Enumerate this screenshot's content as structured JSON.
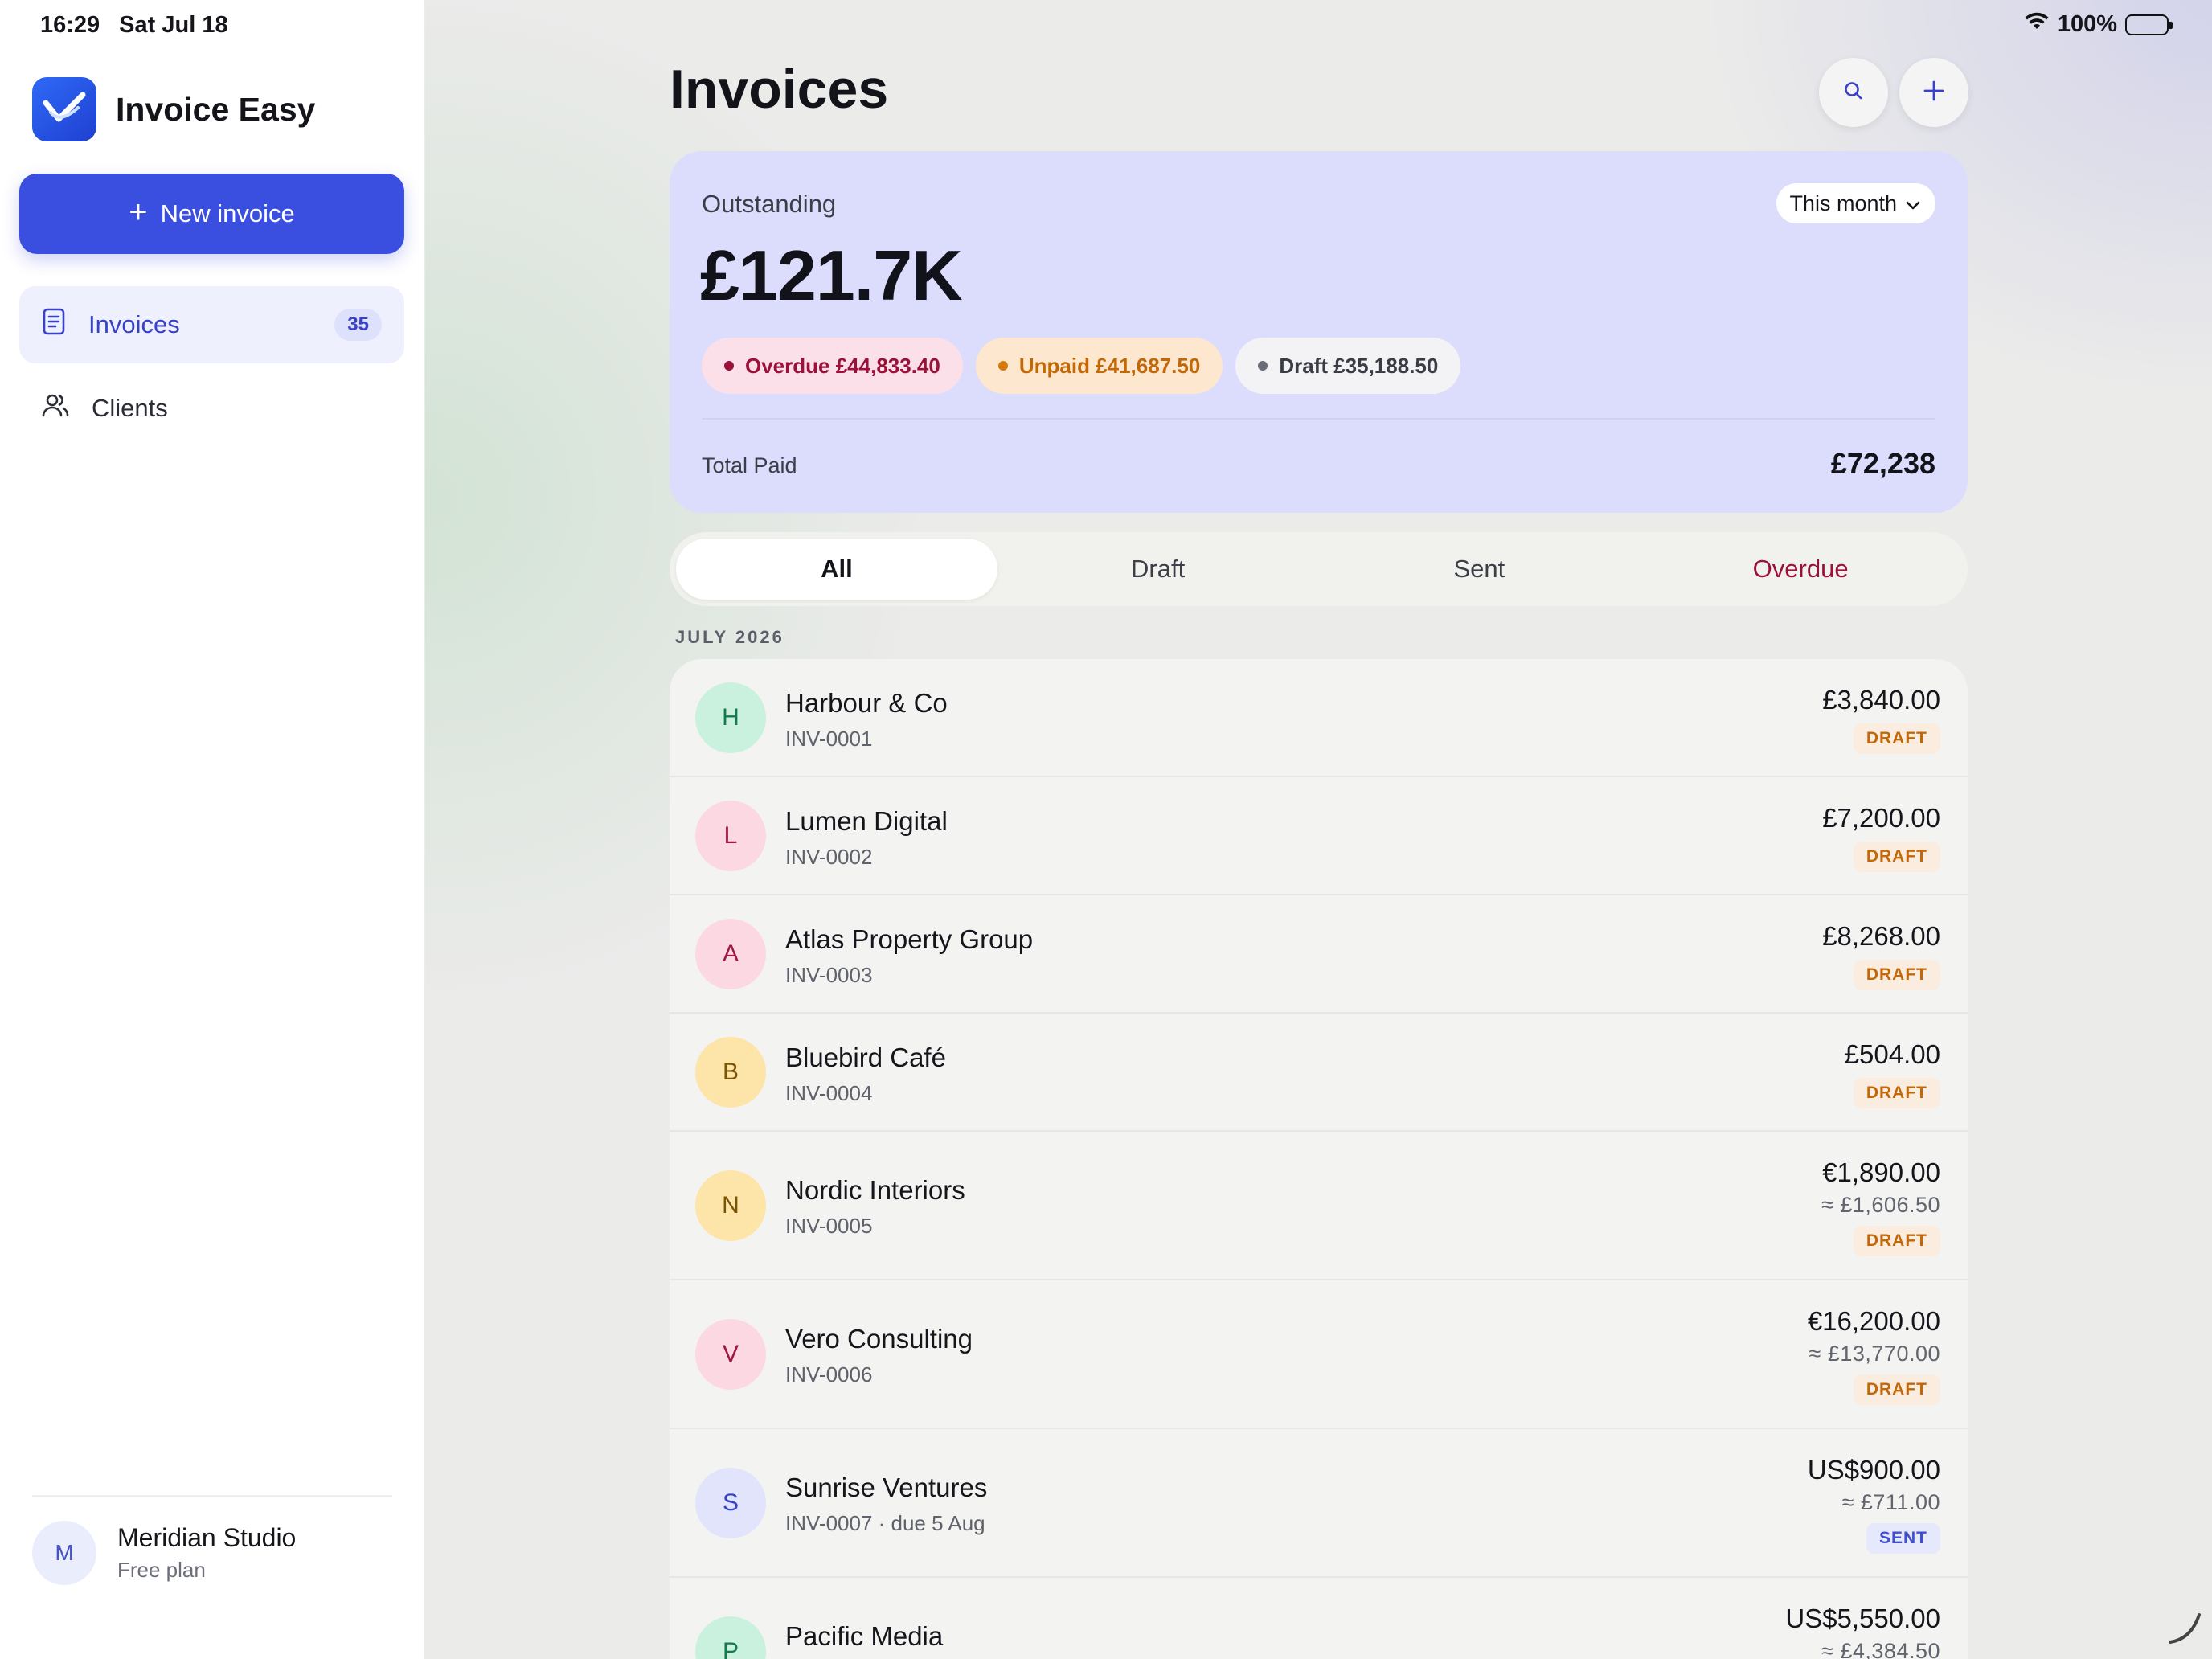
{
  "status_bar": {
    "time": "16:29",
    "date": "Sat Jul 18",
    "battery": "100%",
    "wifi_icon": "wifi-icon",
    "battery_icon": "battery-icon"
  },
  "sidebar": {
    "app_name": "Invoice Easy",
    "new_invoice_label": "New invoice",
    "items": [
      {
        "label": "Invoices",
        "count": "35",
        "icon": "document-icon",
        "active": true
      },
      {
        "label": "Clients",
        "icon": "users-icon",
        "active": false
      }
    ],
    "account": {
      "initial": "M",
      "name": "Meridian Studio",
      "plan": "Free plan"
    }
  },
  "header": {
    "title": "Invoices",
    "search_icon": "search-icon",
    "add_icon": "plus-icon"
  },
  "summary": {
    "label": "Outstanding",
    "period": "This month",
    "amount": "£121.7K",
    "chips": {
      "overdue": "Overdue £44,833.40",
      "unpaid": "Unpaid £41,687.50",
      "draft": "Draft £35,188.50"
    },
    "total_paid_label": "Total Paid",
    "total_paid_value": "£72,238"
  },
  "tabs": [
    "All",
    "Draft",
    "Sent",
    "Overdue"
  ],
  "section_header": "JULY 2026",
  "invoices": [
    {
      "initial": "H",
      "client": "Harbour & Co",
      "number": "INV-0001",
      "amount": "£3,840.00",
      "approx": "",
      "status": "DRAFT"
    },
    {
      "initial": "L",
      "client": "Lumen Digital",
      "number": "INV-0002",
      "amount": "£7,200.00",
      "approx": "",
      "status": "DRAFT"
    },
    {
      "initial": "A",
      "client": "Atlas Property Group",
      "number": "INV-0003",
      "amount": "£8,268.00",
      "approx": "",
      "status": "DRAFT"
    },
    {
      "initial": "B",
      "client": "Bluebird Café",
      "number": "INV-0004",
      "amount": "£504.00",
      "approx": "",
      "status": "DRAFT"
    },
    {
      "initial": "N",
      "client": "Nordic Interiors",
      "number": "INV-0005",
      "amount": "€1,890.00",
      "approx": "≈ £1,606.50",
      "status": "DRAFT"
    },
    {
      "initial": "V",
      "client": "Vero Consulting",
      "number": "INV-0006",
      "amount": "€16,200.00",
      "approx": "≈ £13,770.00",
      "status": "DRAFT"
    },
    {
      "initial": "S",
      "client": "Sunrise Ventures",
      "number": "INV-0007 · due 5 Aug",
      "amount": "US$900.00",
      "approx": "≈ £711.00",
      "status": "SENT"
    },
    {
      "initial": "P",
      "client": "Pacific Media",
      "number": "",
      "amount": "US$5,550.00",
      "approx": "≈ £4,384.50",
      "status": ""
    }
  ],
  "colors": {
    "accent": "#3a4fe0",
    "summary_bg": "#dcdcfd",
    "overdue": "#9a1239",
    "unpaid": "#c26808",
    "avatar_green": "#c9f1dd",
    "avatar_pink": "#fcd9e2",
    "avatar_yellow": "#fde4a9",
    "avatar_indigo": "#e1e4fb"
  }
}
